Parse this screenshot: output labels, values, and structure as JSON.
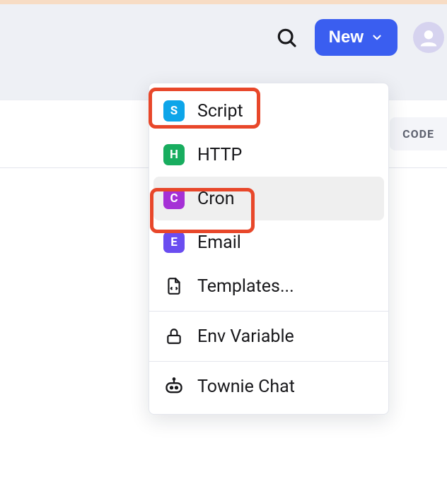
{
  "header": {
    "new_button_label": "New"
  },
  "secondary": {
    "code_label": "CODE"
  },
  "menu": {
    "items": [
      {
        "badge": "S",
        "label": "Script"
      },
      {
        "badge": "H",
        "label": "HTTP"
      },
      {
        "badge": "C",
        "label": "Cron"
      },
      {
        "badge": "E",
        "label": "Email"
      },
      {
        "label": "Templates..."
      },
      {
        "label": "Env Variable"
      },
      {
        "label": "Townie Chat"
      }
    ]
  }
}
